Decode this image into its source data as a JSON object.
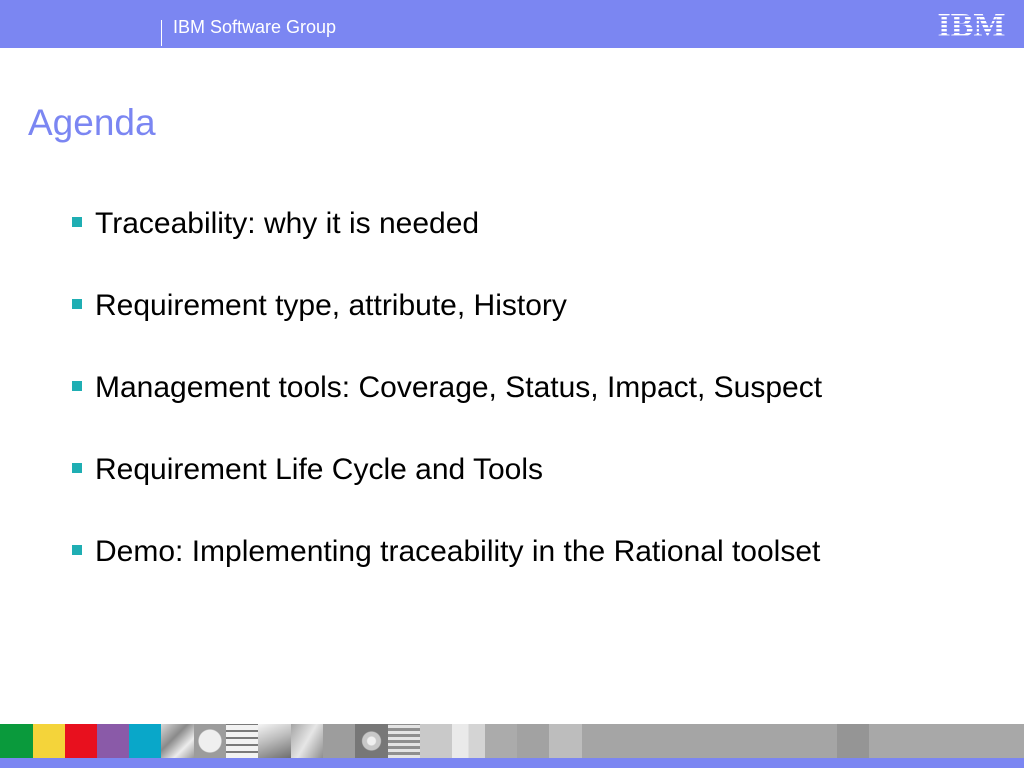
{
  "header": {
    "group_label": "IBM Software Group",
    "logo_text": "IBM",
    "background_color": "#7b86f2"
  },
  "slide": {
    "title": "Agenda",
    "title_color": "#7b86f2",
    "bullet_color": "#1faeb3",
    "bullets": [
      "Traceability: why it is needed",
      "Requirement type, attribute, History",
      "Management tools: Coverage, Status, Impact, Suspect",
      "Requirement Life Cycle and Tools",
      "Demo: Implementing traceability in the Rational toolset"
    ]
  },
  "footer": {
    "color_blocks": [
      "#0a9a3c",
      "#f4d43a",
      "#e8101e",
      "#8a5aa8",
      "#09a7c9"
    ],
    "line_color": "#7b86f2"
  }
}
